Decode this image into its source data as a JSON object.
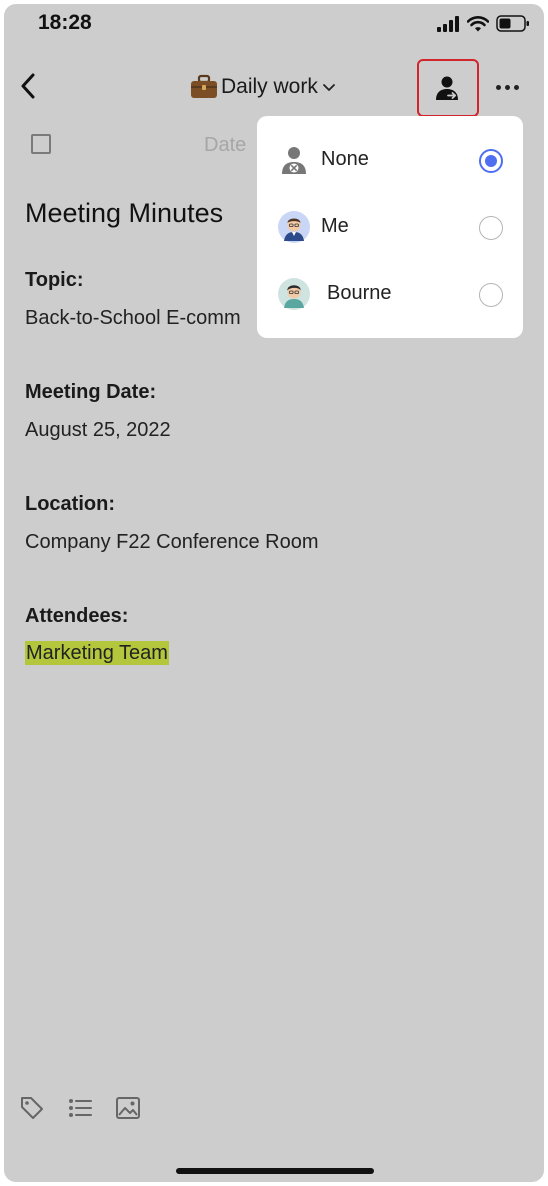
{
  "status_bar": {
    "time": "18:28"
  },
  "nav": {
    "title": "Daily work",
    "title_icon": "briefcase-icon"
  },
  "toolbar": {
    "date_placeholder": "Date"
  },
  "note": {
    "title": "Meeting Minutes",
    "fields": [
      {
        "label": "Topic:",
        "value": "Back-to-School E-comm"
      },
      {
        "label": "Meeting Date:",
        "value": "August 25, 2022"
      },
      {
        "label": "Location:",
        "value": "Company F22 Conference Room"
      },
      {
        "label": "Attendees:",
        "value": "Marketing Team"
      }
    ]
  },
  "assignee_menu": {
    "options": [
      {
        "label": "None",
        "icon": "no-assignee-icon",
        "selected": true
      },
      {
        "label": "Me",
        "icon": "avatar-me",
        "selected": false
      },
      {
        "label": "Bourne",
        "icon": "avatar-bourne",
        "selected": false
      }
    ]
  },
  "colors": {
    "accent": "#4f6ef0",
    "highlight": "#b3c63c",
    "focus_border": "#d0252a",
    "overlay": "#cdcdcd"
  }
}
